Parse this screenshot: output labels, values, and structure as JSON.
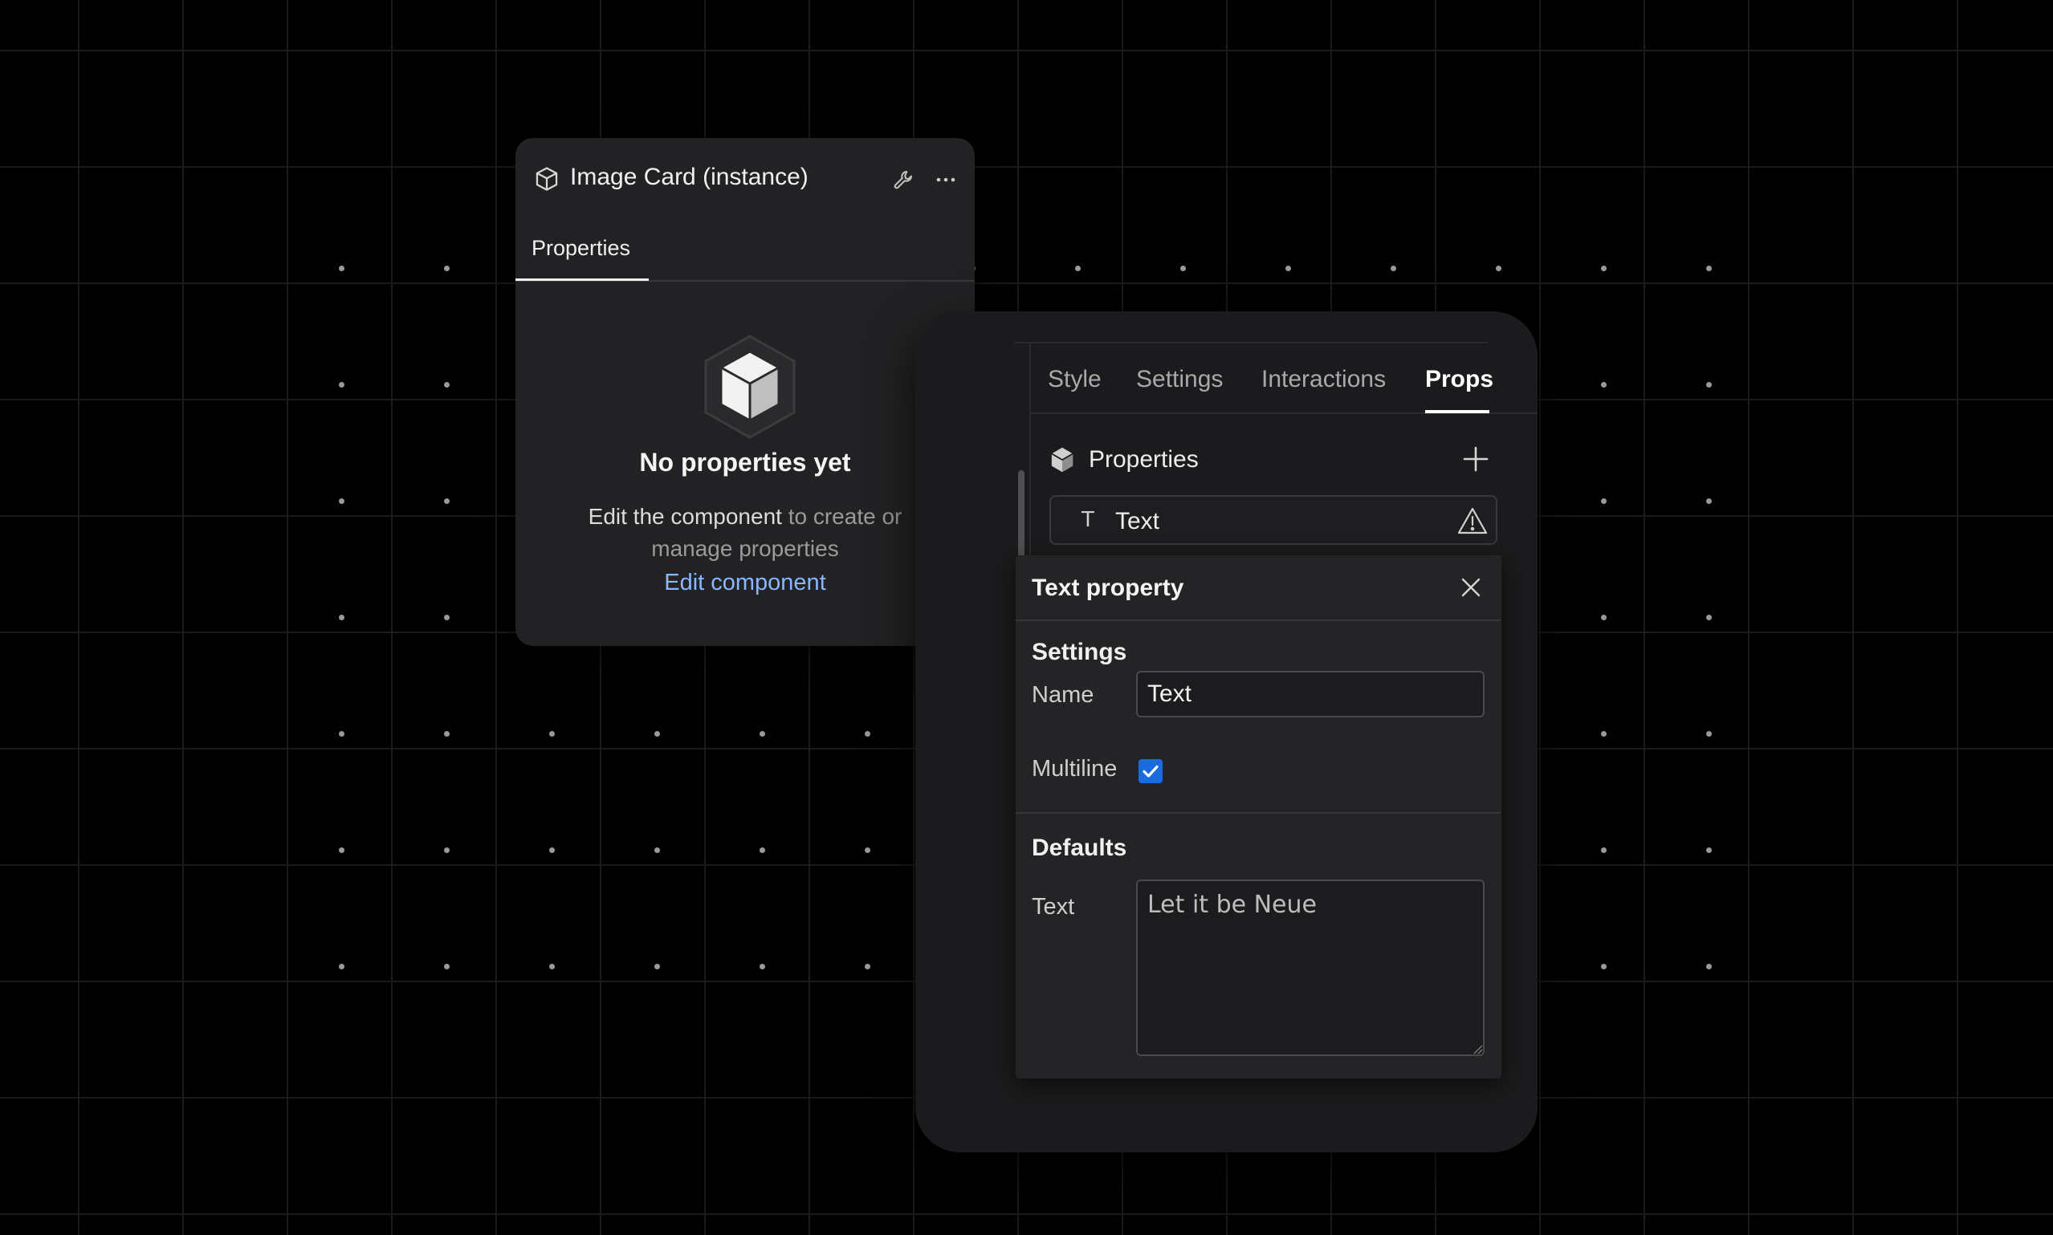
{
  "component_panel": {
    "title": "Image Card (instance)",
    "tab": "Properties",
    "empty_title": "No properties yet",
    "empty_desc_highlight": "Edit the component",
    "empty_desc_rest": " to create or manage properties",
    "edit_link": "Edit component"
  },
  "inspector": {
    "tabs": [
      {
        "label": "Style",
        "active": false
      },
      {
        "label": "Settings",
        "active": false
      },
      {
        "label": "Interactions",
        "active": false
      },
      {
        "label": "Props",
        "active": true
      }
    ],
    "section_label": "Properties",
    "property_item": {
      "icon": "text-type-icon",
      "label": "Text",
      "warning": true
    }
  },
  "text_property_popover": {
    "title": "Text property",
    "settings_title": "Settings",
    "name_label": "Name",
    "name_value": "Text",
    "multiline_label": "Multiline",
    "multiline_checked": true,
    "defaults_title": "Defaults",
    "default_text_label": "Text",
    "default_text_value": "Let it be Neue"
  },
  "colors": {
    "background": "#000000",
    "panel": "#222224",
    "accent_link": "#89b7ff",
    "checkbox": "#1a6be0"
  }
}
